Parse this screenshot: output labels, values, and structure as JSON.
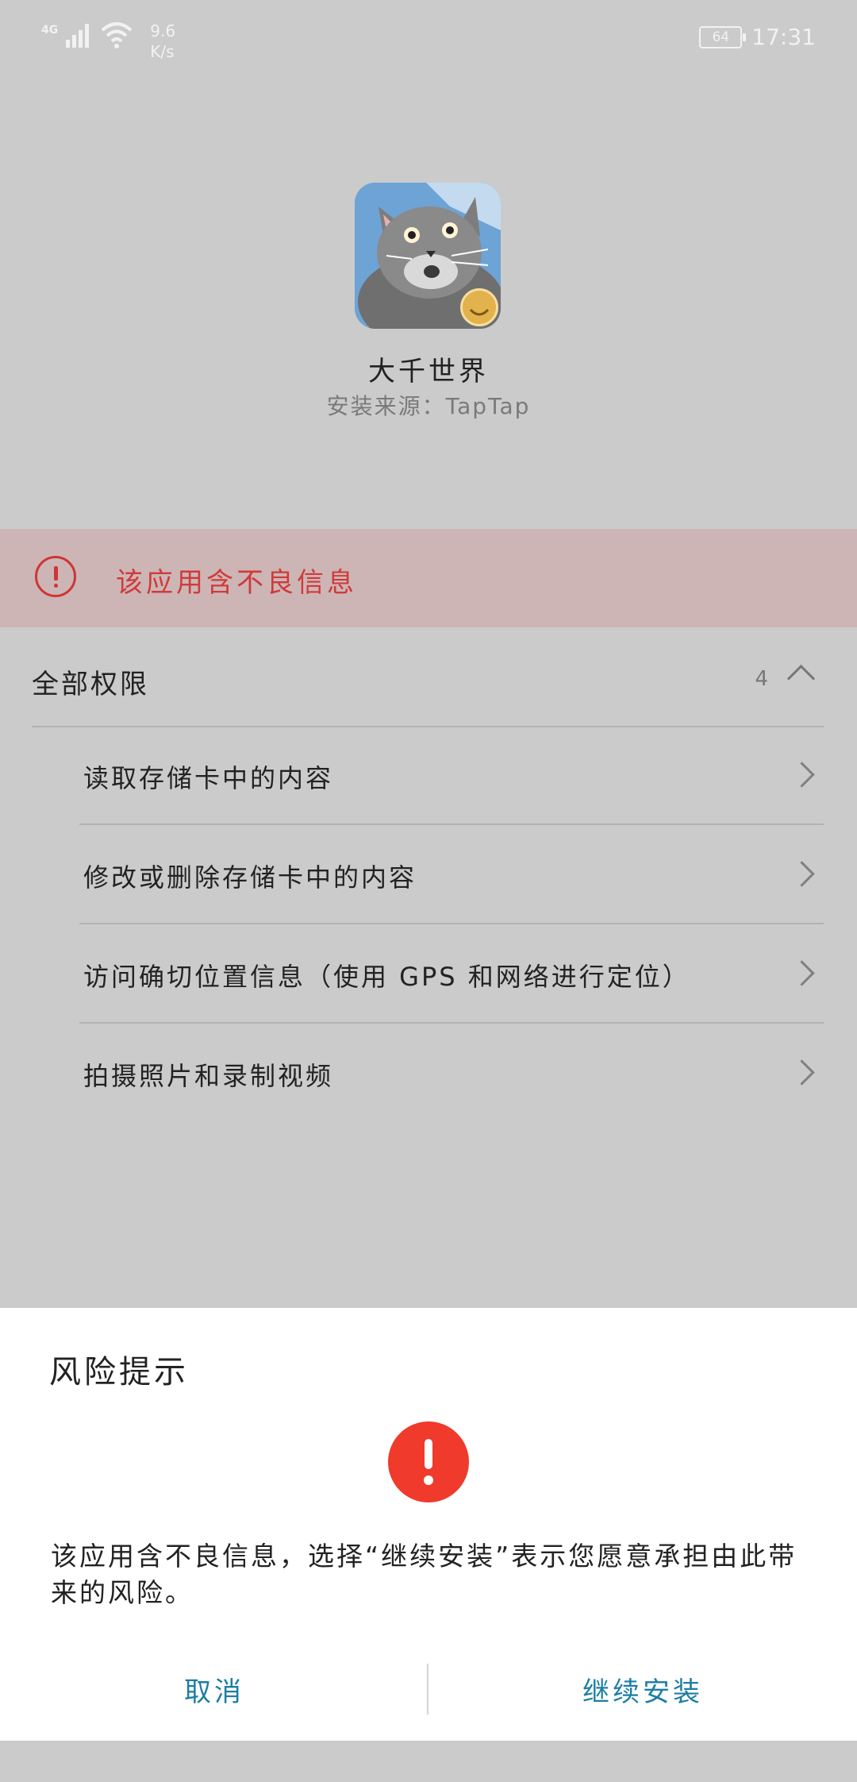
{
  "status_bar": {
    "network": "4G",
    "speed_value": "9.6",
    "speed_unit": "K/s",
    "battery": "64",
    "time": "17:31"
  },
  "app": {
    "name": "大千世界",
    "source": "安装来源：TapTap"
  },
  "warning": {
    "text": "该应用含不良信息"
  },
  "permissions": {
    "title": "全部权限",
    "count": "4",
    "items": [
      "读取存储卡中的内容",
      "修改或删除存储卡中的内容",
      "访问确切位置信息（使用 GPS 和网络进行定位）",
      "拍摄照片和录制视频"
    ]
  },
  "dialog": {
    "title": "风险提示",
    "message": "该应用含不良信息，选择“继续安装”表示您愿意承担由此带来的风险。",
    "cancel_label": "取消",
    "continue_label": "继续安装"
  },
  "colors": {
    "accent": "#1c7ea3",
    "danger": "#f03a2c",
    "warning_text": "#d03a3a",
    "banner_bg": "#cdb5b5"
  }
}
